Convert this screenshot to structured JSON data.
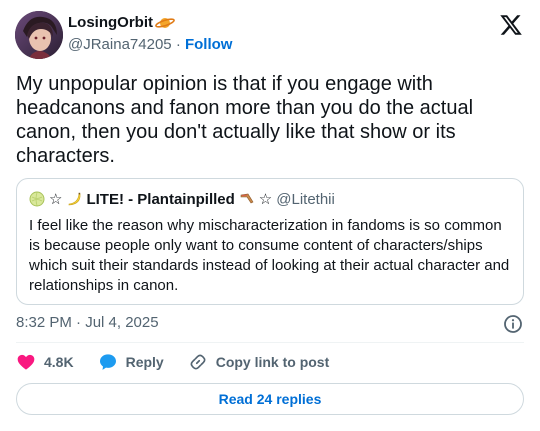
{
  "author": {
    "display_name": "LosingOrbit",
    "handle": "@JRaina74205",
    "separator": "·",
    "follow_label": "Follow",
    "name_emoji_icon": "ringed-planet-icon"
  },
  "tweet": {
    "text": "My unpopular opinion is that if you engage with headcanons and fanon more than you do the actual canon, then you don't actually like that show or its characters."
  },
  "quote": {
    "name_prefix_icons": [
      "melon-icon",
      "star-icon",
      "banana-icon"
    ],
    "name": "LITE! - Plantainpilled",
    "name_suffix_icons": [
      "boomerang-icon",
      "star-icon"
    ],
    "star_glyph": "☆",
    "handle": "@Litethii",
    "text": "I feel like the reason why mischaracterization in fandoms is so common is because people only want to consume content of characters/ships which suit their standards instead of looking at their actual character and relationships in canon."
  },
  "timestamp": "8:32 PM · Jul 4, 2025",
  "actions": {
    "like_count": "4.8K",
    "reply_label": "Reply",
    "copy_label": "Copy link to post"
  },
  "read_replies_label": "Read 24 replies",
  "colors": {
    "like": "#f91880",
    "reply": "#1d9bf0",
    "link": "#006fd6",
    "secondary_text": "#536471",
    "border": "#cfd9de"
  }
}
